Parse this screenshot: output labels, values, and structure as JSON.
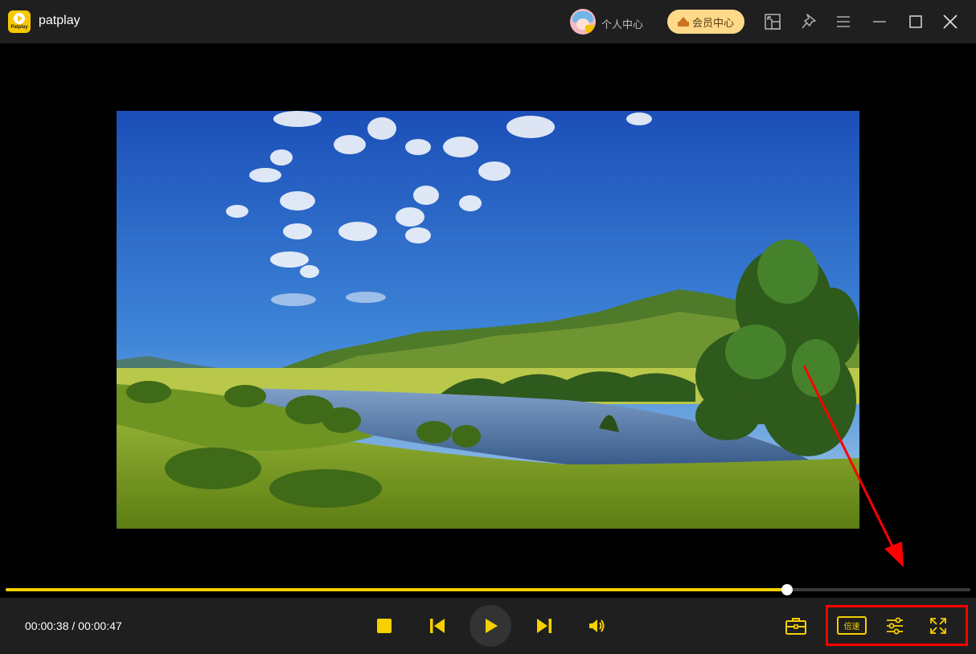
{
  "app": {
    "name": "patplay",
    "logo_text": "Patplay"
  },
  "header": {
    "user_center_label": "个人中心",
    "vip_center_label": "会员中心"
  },
  "player": {
    "current_time": "00:00:38",
    "separator": " / ",
    "total_time": "00:00:47",
    "progress": 0.81,
    "speed_label": "倍速"
  },
  "colors": {
    "accent": "#f6d000",
    "annotation": "#ff0000",
    "bar_bg": "#1f1f1f"
  },
  "icons": {
    "title_bar": [
      "mini-mode-icon",
      "pin-icon",
      "menu-icon",
      "minimize-icon",
      "maximize-icon",
      "close-icon"
    ],
    "controls": [
      "stop-icon",
      "previous-icon",
      "play-icon",
      "next-icon",
      "volume-icon",
      "toolbox-icon",
      "speed-icon",
      "settings-sliders-icon",
      "fullscreen-icon"
    ]
  }
}
